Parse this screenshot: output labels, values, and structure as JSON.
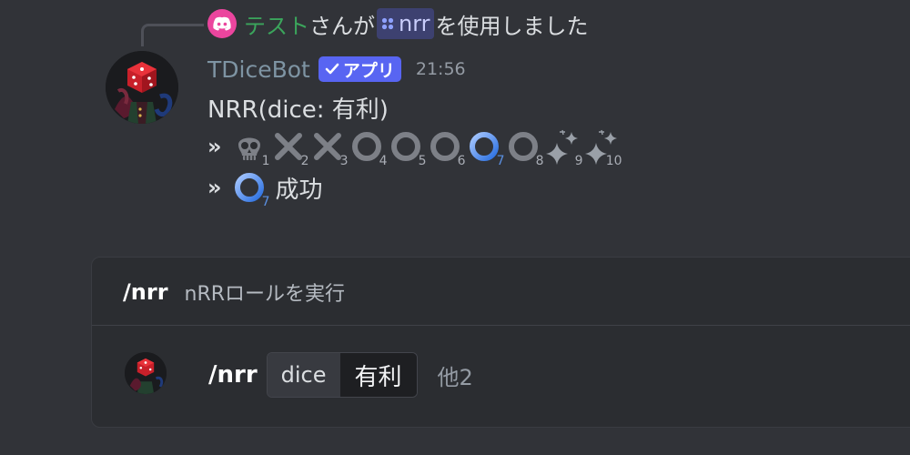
{
  "reply": {
    "user": "テスト",
    "text_middle": "さんが",
    "command": "nrr",
    "text_end": "を使用しました",
    "user_color": "#3ba55c"
  },
  "message": {
    "username": "TDiceBot",
    "badge": "アプリ",
    "timestamp": "21:56",
    "line1": "NRR(dice: 有利)",
    "chevron": "»",
    "dice": [
      {
        "n": "1",
        "icon": "skull-icon"
      },
      {
        "n": "2",
        "icon": "cross-icon"
      },
      {
        "n": "3",
        "icon": "cross-icon"
      },
      {
        "n": "4",
        "icon": "ring-icon"
      },
      {
        "n": "5",
        "icon": "ring-icon"
      },
      {
        "n": "6",
        "icon": "ring-icon"
      },
      {
        "n": "7",
        "icon": "blue-ring-icon"
      },
      {
        "n": "8",
        "icon": "ring-icon"
      },
      {
        "n": "9",
        "icon": "sparkle-icon"
      },
      {
        "n": "10",
        "icon": "sparkle-icon"
      }
    ],
    "result_num": "7",
    "result_text": "成功"
  },
  "command_panel": {
    "name": "/nrr",
    "description": "nRRロールを実行",
    "usage_command": "/nrr",
    "option_name": "dice",
    "option_value": "有利",
    "more": "他2"
  },
  "colors": {
    "background": "#313338",
    "blurple": "#5865f2",
    "panel": "#2b2d31"
  }
}
